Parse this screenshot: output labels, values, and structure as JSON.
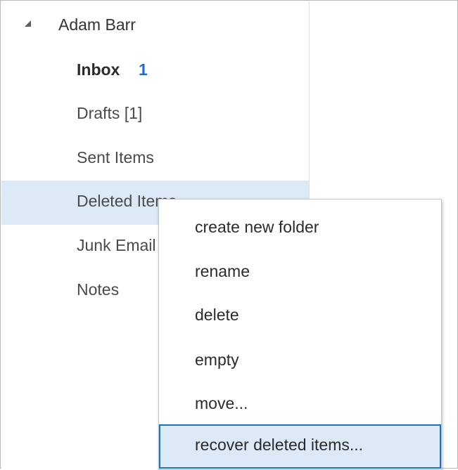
{
  "account": {
    "name": "Adam Barr"
  },
  "folders": [
    {
      "label": "Inbox",
      "count": "1"
    },
    {
      "label": "Drafts [1]"
    },
    {
      "label": "Sent Items"
    },
    {
      "label": "Deleted Items"
    },
    {
      "label": "Junk Email"
    },
    {
      "label": "Notes"
    }
  ],
  "context_menu": {
    "items": [
      {
        "label": "create new folder"
      },
      {
        "label": "rename"
      },
      {
        "label": "delete"
      },
      {
        "label": "empty"
      },
      {
        "label": "move..."
      },
      {
        "label": "recover deleted items..."
      }
    ]
  },
  "colors": {
    "selection": "#dce9f6",
    "focus_border": "#1b73c5",
    "unread_accent": "#1e6fc4"
  },
  "icons": {
    "collapse": "triangle-collapse-icon"
  }
}
